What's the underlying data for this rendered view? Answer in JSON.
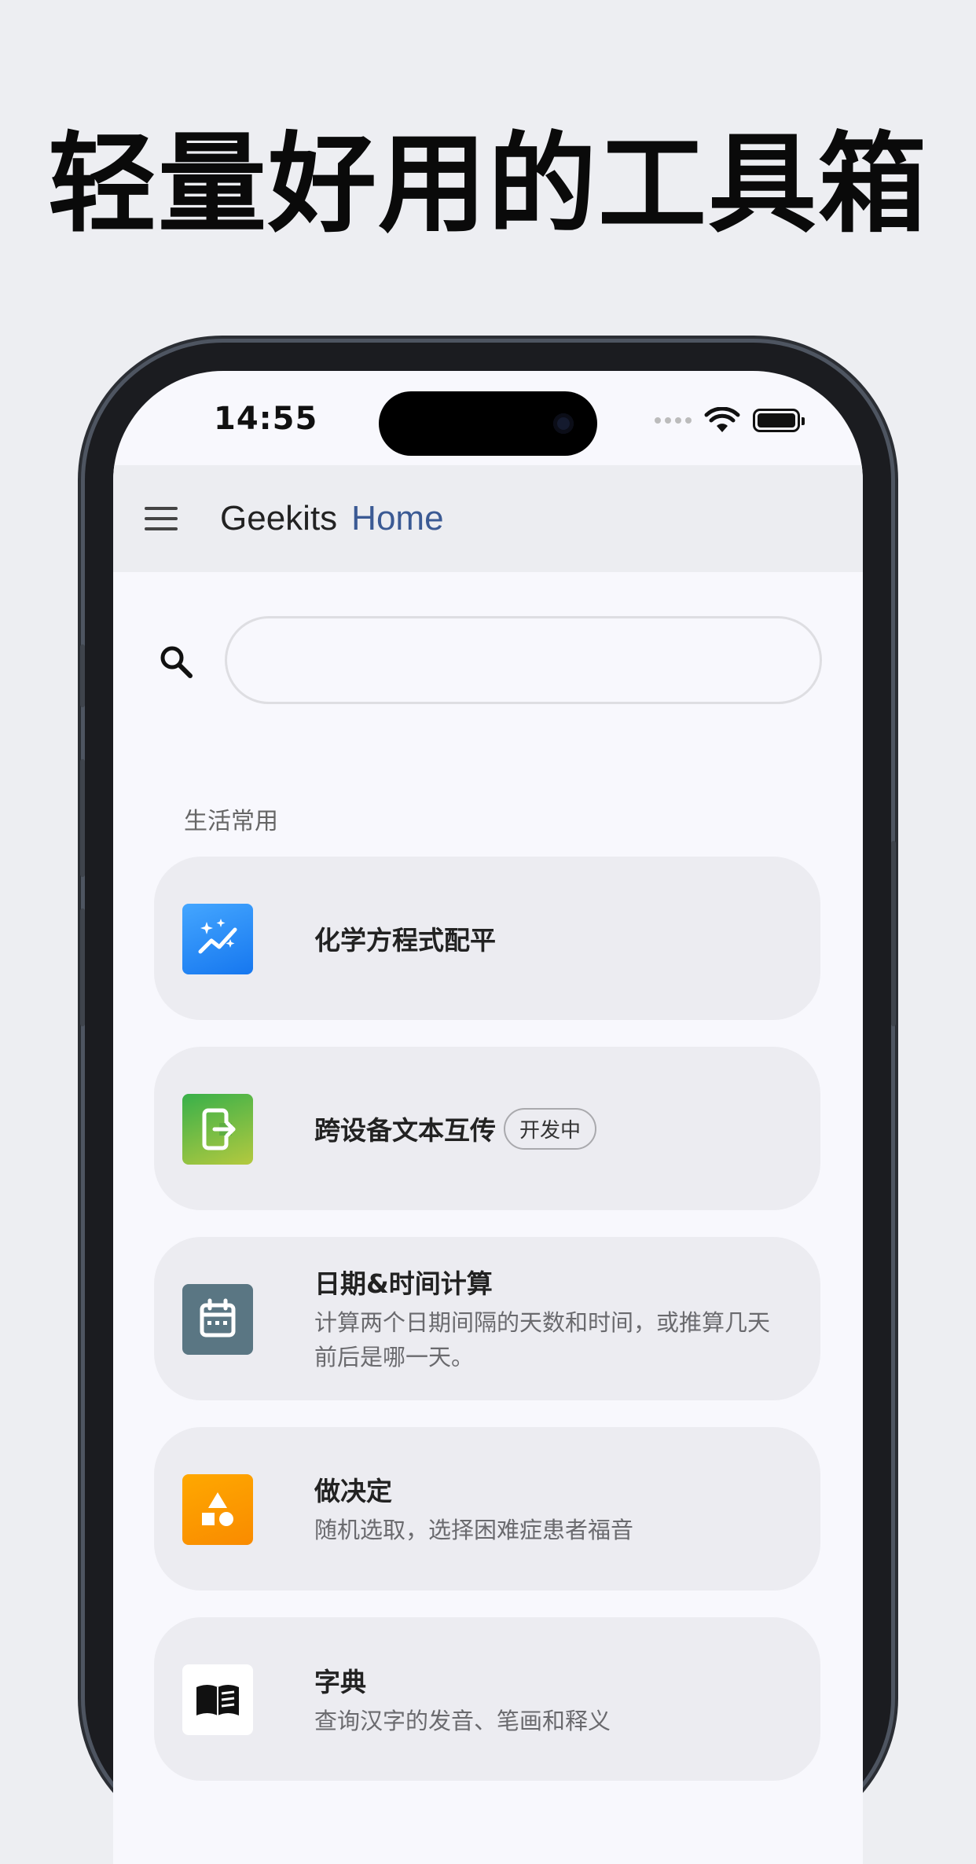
{
  "headline": "轻量好用的工具箱",
  "status_bar": {
    "time": "14:55"
  },
  "app_bar": {
    "title": "Geekits",
    "subtitle": "Home"
  },
  "search": {
    "placeholder": ""
  },
  "section": {
    "label": "生活常用"
  },
  "tools": [
    {
      "title": "化学方程式配平",
      "desc": "",
      "badge": "",
      "icon": "sparkle-chart-icon",
      "color": "#2d8df5"
    },
    {
      "title": "跨设备文本互传",
      "desc": "",
      "badge": "开发中",
      "icon": "device-transfer-icon",
      "color": "#6fb844"
    },
    {
      "title": "日期&时间计算",
      "desc": "计算两个日期间隔的天数和时间，或推算几天前后是哪一天。",
      "badge": "",
      "icon": "calendar-icon",
      "color": "#5a7683"
    },
    {
      "title": "做决定",
      "desc": "随机选取，选择困难症患者福音",
      "badge": "",
      "icon": "shapes-icon",
      "color": "#fd9d00"
    },
    {
      "title": "字典",
      "desc": "查询汉字的发音、笔画和释义",
      "badge": "",
      "icon": "book-icon",
      "color": "#ffffff"
    }
  ]
}
